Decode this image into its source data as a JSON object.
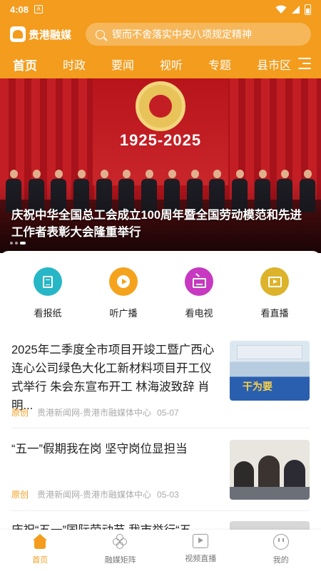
{
  "status_bar": {
    "time": "4:08",
    "app_icon": "A"
  },
  "header": {
    "brand_name": "贵港融媒",
    "search_placeholder": "锲而不舍落实中央八项规定精神"
  },
  "nav_tabs": [
    {
      "label": "首页",
      "active": true
    },
    {
      "label": "时政"
    },
    {
      "label": "要闻"
    },
    {
      "label": "视听"
    },
    {
      "label": "专题"
    },
    {
      "label": "县市区"
    }
  ],
  "banner": {
    "year_text": "1925-2025",
    "caption": "庆祝中华全国总工会成立100周年暨全国劳动模范和先进工作者表彰大会隆重举行"
  },
  "quick_links": [
    {
      "label": "看报纸",
      "color": "#27b6c6",
      "icon": "newspaper-icon"
    },
    {
      "label": "听广播",
      "color": "#f5a31d",
      "icon": "radio-play-icon"
    },
    {
      "label": "看电视",
      "color": "#c739c0",
      "icon": "tv-icon"
    },
    {
      "label": "看直播",
      "color": "#dcb32a",
      "icon": "live-icon"
    }
  ],
  "news": [
    {
      "title": "2025年二季度全市项目开竣工暨广西心连心公司绿色大化工新材料项目开工仪式举行 朱会东宣布开工 林海波致辞 肖明...",
      "tag": "原创",
      "source": "贵港新闻网-贵港市融媒体中心",
      "date": "05-07",
      "thumb_text": "干为要"
    },
    {
      "title": "“五一”假期我在岗 坚守岗位显担当",
      "tag": "原创",
      "source": "贵港新闻网-贵港市融媒体中心",
      "date": "05-03"
    },
    {
      "title": "庆祝“五一”国际劳动节 我市举行“五"
    }
  ],
  "bottom_nav": [
    {
      "label": "首页",
      "active": true
    },
    {
      "label": "融媒矩阵"
    },
    {
      "label": "视频直播"
    },
    {
      "label": "我的"
    }
  ],
  "colors": {
    "brand": "#f39c1d",
    "text": "#222222",
    "meta": "#aaaaaa"
  }
}
